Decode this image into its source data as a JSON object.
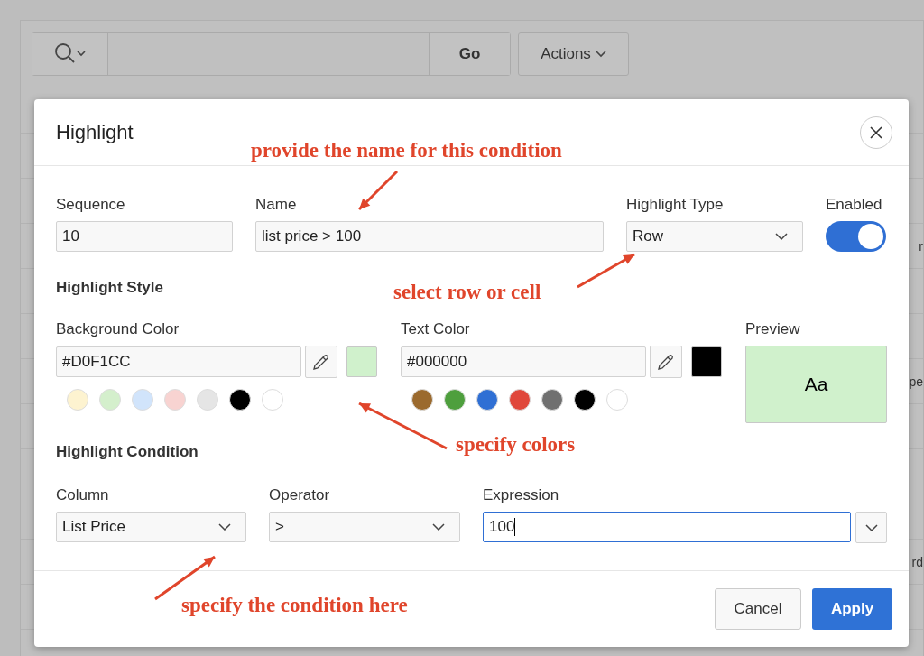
{
  "toolbar": {
    "go_button": "Go",
    "actions_button": "Actions"
  },
  "background_fragments": [
    "r",
    "pe",
    "rd"
  ],
  "dialog": {
    "title": "Highlight",
    "sequence": {
      "label": "Sequence",
      "value": "10"
    },
    "name": {
      "label": "Name",
      "value": "list price > 100"
    },
    "highlight_type": {
      "label": "Highlight Type",
      "value": "Row"
    },
    "enabled": {
      "label": "Enabled",
      "on": true
    },
    "highlight_style": {
      "heading": "Highlight Style",
      "background_color": {
        "label": "Background Color",
        "value": "#D0F1CC",
        "swatches": [
          {
            "color": "#fdf3d0"
          },
          {
            "color": "#d4efcc"
          },
          {
            "color": "#d1e4fb"
          },
          {
            "color": "#f8d3d1"
          },
          {
            "color": "#e5e5e5"
          },
          {
            "color": "#000000"
          },
          {
            "color": "#ffffff"
          }
        ]
      },
      "text_color": {
        "label": "Text Color",
        "value": "#000000",
        "swatches": [
          {
            "color": "#9b6a2e"
          },
          {
            "color": "#4e9f3d"
          },
          {
            "color": "#2f6fd4"
          },
          {
            "color": "#e0473b"
          },
          {
            "color": "#707070"
          },
          {
            "color": "#000000"
          },
          {
            "color": "#ffffff"
          }
        ]
      },
      "preview": {
        "label": "Preview",
        "sample": "Aa"
      }
    },
    "highlight_condition": {
      "heading": "Highlight Condition",
      "column": {
        "label": "Column",
        "value": "List Price"
      },
      "operator": {
        "label": "Operator",
        "value": ">"
      },
      "expression": {
        "label": "Expression",
        "value": "100",
        "focused": true
      }
    },
    "buttons": {
      "cancel": "Cancel",
      "apply": "Apply"
    }
  },
  "annotations": [
    "provide the name for this condition",
    "select row or cell",
    "specify colors",
    "specify the condition here"
  ]
}
